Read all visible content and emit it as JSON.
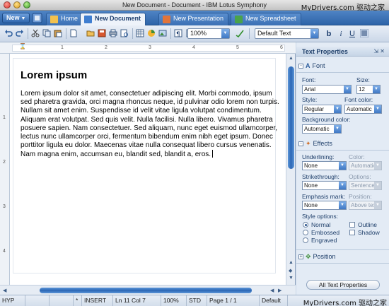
{
  "window": {
    "title": "New Document - Document - IBM Lotus Symphony",
    "watermark_top": "MyDrivers.com 驱动之家",
    "watermark_bottom": "MyDrivers.com 驱动之家"
  },
  "tabbar": {
    "new_label": "New",
    "tabs": [
      {
        "label": "Home",
        "active": false,
        "icon": "home-icon"
      },
      {
        "label": "New Document",
        "active": true,
        "icon": "document-icon"
      },
      {
        "label": "New Presentation",
        "active": false,
        "icon": "presentation-icon"
      },
      {
        "label": "New Spreadsheet",
        "active": false,
        "icon": "spreadsheet-icon"
      }
    ]
  },
  "toolbar": {
    "zoom": "100%",
    "paragraph_style": "Default Text",
    "bold": "b",
    "italic": "i",
    "underline": "U"
  },
  "document": {
    "heading": "Lorem ipsum",
    "body": "Lorem ipsum dolor sit amet, consectetuer adipiscing elit. Morbi commodo, ipsum sed pharetra gravida, orci magna rhoncus neque, id pulvinar odio lorem non turpis. Nullam sit amet enim. Suspendisse id velit vitae ligula volutpat condimentum. Aliquam erat volutpat. Sed quis velit. Nulla facilisi. Nulla libero. Vivamus pharetra posuere sapien. Nam consectetuer. Sed aliquam, nunc eget euismod ullamcorper, lectus nunc ullamcorper orci, fermentum bibendum enim nibh eget ipsum. Donec porttitor ligula eu dolor. Maecenas vitae nulla consequat libero cursus venenatis. Nam magna enim, accumsan eu, blandit sed, blandit a, eros.",
    "hruler_marks": [
      "1",
      "2",
      "3",
      "4",
      "5",
      "6"
    ],
    "vruler_marks": [
      "1",
      "2",
      "3",
      "4"
    ]
  },
  "panel": {
    "title": "Text Properties",
    "font_section": "Font",
    "font_label": "Font:",
    "font_value": "Arial",
    "size_label": "Size:",
    "size_value": "12",
    "style_label": "Style:",
    "style_value": "Regular",
    "font_color_label": "Font color:",
    "font_color_value": "Automatic",
    "bg_color_label": "Background color:",
    "bg_color_value": "Automatic",
    "effects_section": "Effects",
    "underlining_label": "Underlining:",
    "underlining_value": "None",
    "color_label": "Color:",
    "color_value": "Automatic",
    "strikethrough_label": "Strikethrough:",
    "strikethrough_value": "None",
    "options_label": "Options:",
    "options_value": "Sentence",
    "emphasis_label": "Emphasis mark:",
    "emphasis_value": "None",
    "position_label": "Position:",
    "position_value": "Above tex",
    "style_options_label": "Style options:",
    "opt_normal": "Normal",
    "opt_embossed": "Embossed",
    "opt_engraved": "Engraved",
    "opt_outline": "Outline",
    "opt_shadow": "Shadow",
    "position_section": "Position",
    "all_button": "All Text Properties"
  },
  "statusbar": {
    "hyp": "HYP",
    "modified": "*",
    "insert": "INSERT",
    "position": "Ln 11 Col 7",
    "zoom": "100%",
    "std": "STD",
    "page": "Page 1 / 1",
    "style": "Default"
  },
  "colors": {
    "accent": "#2e64a8",
    "panel_bg": "#e3ebf5",
    "scroll_thumb": "#2a66b5"
  }
}
